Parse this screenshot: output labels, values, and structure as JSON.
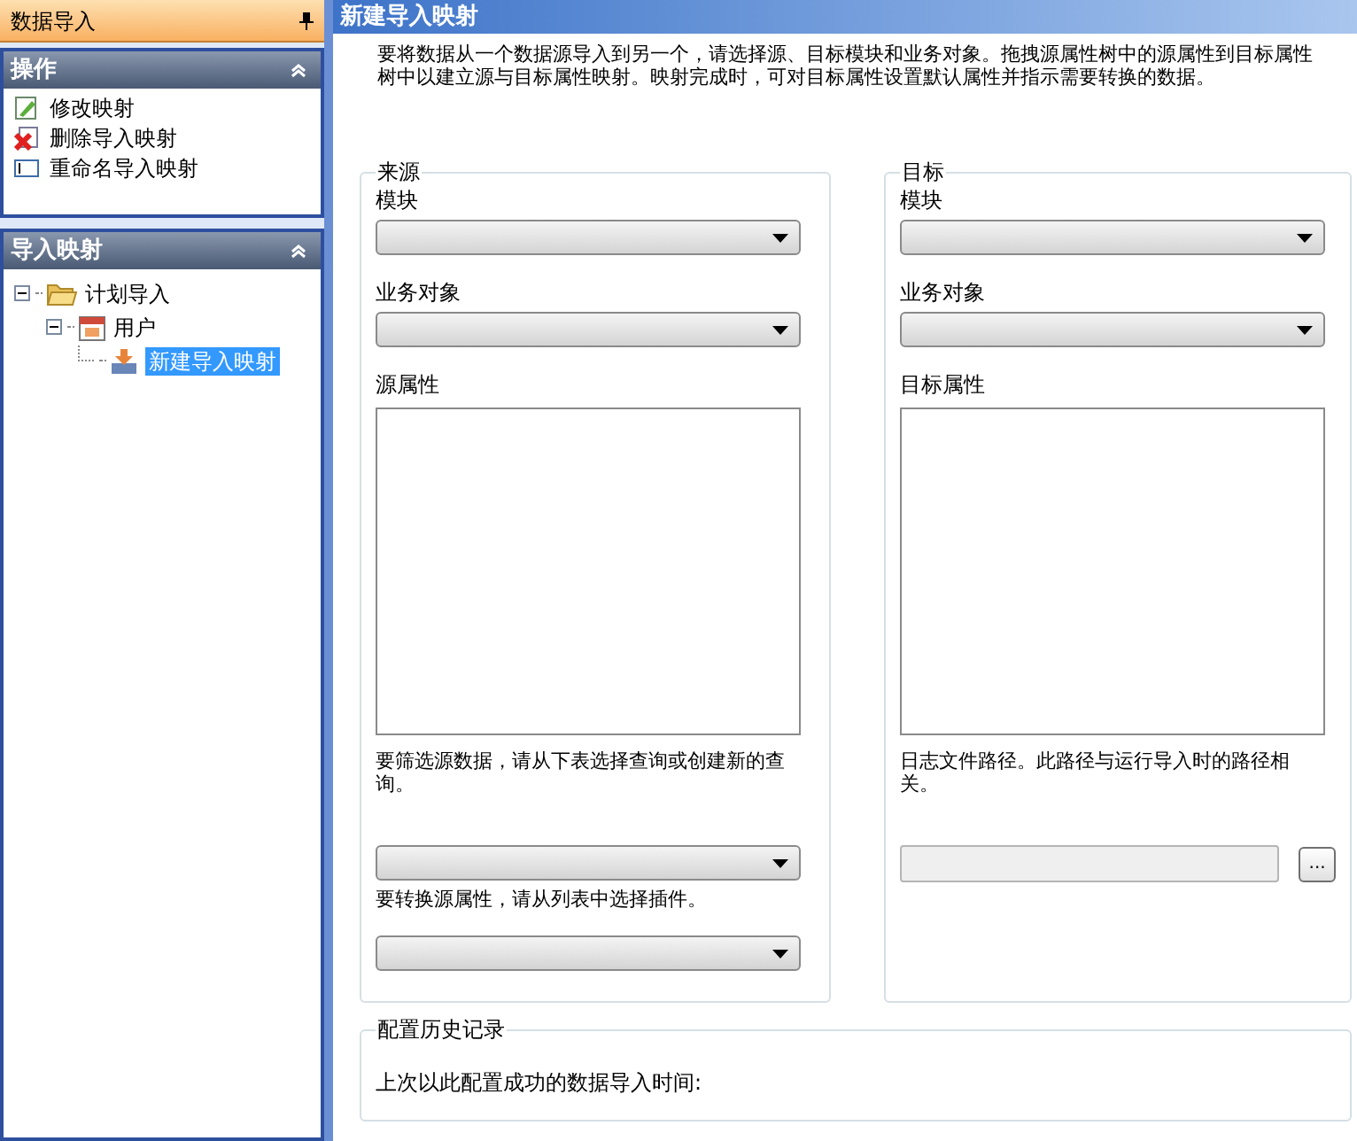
{
  "dock": {
    "title": "数据导入"
  },
  "actions": {
    "title": "操作",
    "expanded": true,
    "items": [
      {
        "kind": "edit",
        "label": "修改映射"
      },
      {
        "kind": "delete",
        "label": "删除导入映射"
      },
      {
        "kind": "rename",
        "label": "重命名导入映射"
      }
    ]
  },
  "mappings": {
    "title": "导入映射",
    "expanded": true,
    "tree": [
      {
        "kind": "folder",
        "label": "计划导入",
        "expanded": true,
        "selected": false,
        "children": [
          {
            "kind": "calendar",
            "label": "用户",
            "expanded": true,
            "selected": false,
            "children": [
              {
                "kind": "mapping",
                "label": "新建导入映射",
                "selected": true
              }
            ]
          }
        ]
      }
    ]
  },
  "main": {
    "title": "新建导入映射",
    "description": "要将数据从一个数据源导入到另一个，请选择源、目标模块和业务对象。拖拽源属性树中的源属性到目标属性树中以建立源与目标属性映射。映射完成时，可对目标属性设置默认属性并指示需要转换的数据。"
  },
  "source": {
    "title": "来源",
    "module_label": "模块",
    "object_label": "业务对象",
    "attributes_label": "源属性",
    "filter_hint": "要筛选源数据，请从下表选择查询或创建新的查询。",
    "transform_hint": "要转换源属性，请从列表中选择插件。"
  },
  "target": {
    "title": "目标",
    "module_label": "模块",
    "object_label": "业务对象",
    "attributes_label": "目标属性",
    "log_hint": "日志文件路径。此路径与运行导入时的路径相关。",
    "browse_button": "..."
  },
  "history": {
    "title": "配置历史记录",
    "last_import_label": "上次以此配置成功的数据导入时间:"
  }
}
